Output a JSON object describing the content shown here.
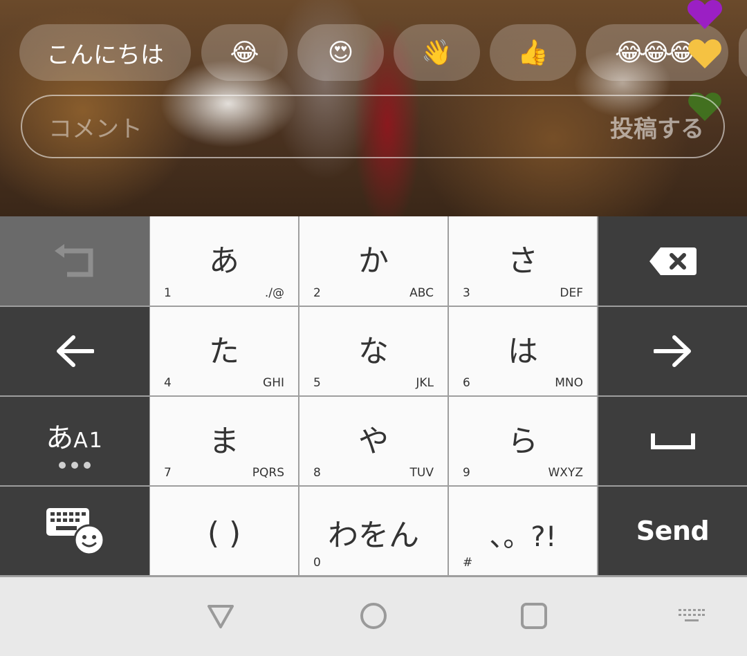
{
  "quick_replies": [
    {
      "label": "こんにちは",
      "kind": "text"
    },
    {
      "label": "😂",
      "kind": "emoji"
    },
    {
      "label": "😍",
      "kind": "emoji"
    },
    {
      "label": "👋",
      "kind": "emoji"
    },
    {
      "label": "👍",
      "kind": "emoji"
    },
    {
      "label": "😂😂😂",
      "kind": "emoji"
    }
  ],
  "comment": {
    "placeholder": "コメント",
    "post_label": "投稿する"
  },
  "hearts": [
    "purple-heart-icon",
    "yellow-heart-icon",
    "green-heart-icon"
  ],
  "keyboard": {
    "rows": [
      [
        {
          "main": "あ",
          "num": "1",
          "sub": "./@"
        },
        {
          "main": "か",
          "num": "2",
          "sub": "ABC"
        },
        {
          "main": "さ",
          "num": "3",
          "sub": "DEF"
        }
      ],
      [
        {
          "main": "た",
          "num": "4",
          "sub": "GHI"
        },
        {
          "main": "な",
          "num": "5",
          "sub": "JKL"
        },
        {
          "main": "は",
          "num": "6",
          "sub": "MNO"
        }
      ],
      [
        {
          "main": "ま",
          "num": "7",
          "sub": "PQRS"
        },
        {
          "main": "や",
          "num": "8",
          "sub": "TUV"
        },
        {
          "main": "ら",
          "num": "9",
          "sub": "WXYZ"
        }
      ],
      [
        {
          "main": "( )",
          "num": "",
          "sub": ""
        },
        {
          "main": "わをん",
          "num": "0",
          "sub": ""
        },
        {
          "main": "、。?!",
          "num": "#",
          "sub": ""
        }
      ]
    ],
    "mode_label_big": "あ",
    "mode_label_small": "A1",
    "send_label": "Send",
    "left_keys": [
      "undo-icon",
      "arrow-left-icon",
      "input-mode-key",
      "keyboard-emoji-icon"
    ],
    "right_keys": [
      "backspace-icon",
      "arrow-right-icon",
      "space-icon",
      "send-key"
    ]
  },
  "nav": [
    "back-icon",
    "home-icon",
    "recents-icon",
    "keyboard-switch-icon"
  ],
  "colors": {
    "key_dark": "#3d3d3d",
    "key_white": "#fafafa",
    "heart_purple": "#9b1fc4",
    "heart_yellow": "#f5c242",
    "heart_green": "#3f7a1e"
  }
}
